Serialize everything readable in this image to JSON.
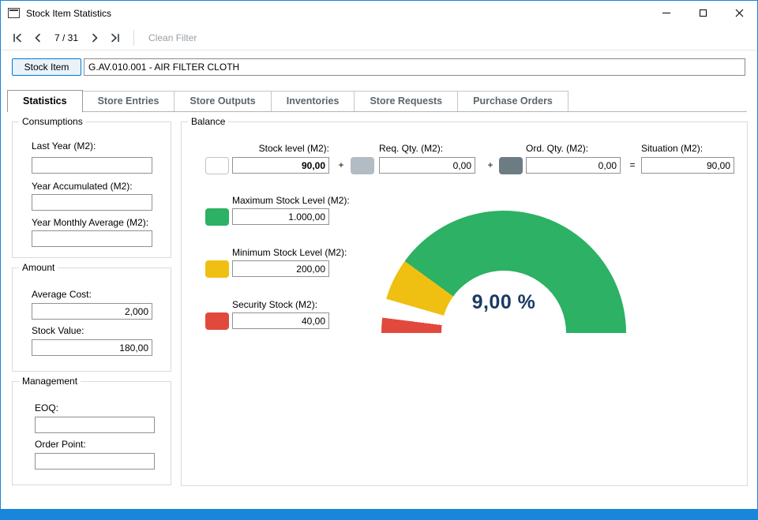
{
  "window": {
    "title": "Stock Item Statistics"
  },
  "toolbar": {
    "position": "7 / 31",
    "clean_filter": "Clean Filter"
  },
  "stock_item": {
    "button": "Stock Item",
    "value": "G.AV.010.001 - AIR FILTER CLOTH"
  },
  "tabs": {
    "items": [
      {
        "label": "Statistics",
        "active": true
      },
      {
        "label": "Store Entries",
        "active": false
      },
      {
        "label": "Store Outputs",
        "active": false
      },
      {
        "label": "Inventories",
        "active": false
      },
      {
        "label": "Store Requests",
        "active": false
      },
      {
        "label": "Purchase Orders",
        "active": false
      }
    ]
  },
  "panels": {
    "consumptions": {
      "legend": "Consumptions",
      "fields": [
        {
          "label": "Last Year (M2):",
          "value": ""
        },
        {
          "label": "Year Accumulated (M2):",
          "value": ""
        },
        {
          "label": "Year Monthly Average (M2):",
          "value": ""
        }
      ]
    },
    "amount": {
      "legend": "Amount",
      "fields": [
        {
          "label": "Average Cost:",
          "value": "2,000"
        },
        {
          "label": "Stock Value:",
          "value": "180,00"
        }
      ]
    },
    "management": {
      "legend": "Management",
      "fields": [
        {
          "label": "EOQ:",
          "value": ""
        },
        {
          "label": "Order Point:",
          "value": ""
        }
      ]
    }
  },
  "balance": {
    "legend": "Balance",
    "operators": [
      "+",
      "+",
      "="
    ],
    "equation": {
      "stock_level": {
        "label": "Stock level (M2):",
        "value": "90,00"
      },
      "req_qty": {
        "label": "Req. Qty. (M2):",
        "value": "0,00"
      },
      "ord_qty": {
        "label": "Ord. Qty. (M2):",
        "value": "0,00"
      },
      "situation": {
        "label": "Situation (M2):",
        "value": "90,00"
      }
    },
    "levels": [
      {
        "label": "Maximum Stock Level (M2):",
        "value": "1.000,00",
        "color": "#2cb165"
      },
      {
        "label": "Minimum Stock  Level (M2):",
        "value": "200,00",
        "color": "#efc012"
      },
      {
        "label": "Security Stock (M2):",
        "value": "40,00",
        "color": "#e1493d"
      }
    ],
    "gauge": {
      "percent_label": "9,00 %",
      "sweep_deg": 180,
      "segments": [
        {
          "name": "security-zone",
          "color": "#e1493d",
          "from_pct": 0,
          "to_pct": 4
        },
        {
          "name": "current-stock-marker",
          "color": "#ffffff",
          "from_pct": 4,
          "to_pct": 9
        },
        {
          "name": "minimum-zone",
          "color": "#efc012",
          "from_pct": 9,
          "to_pct": 20
        },
        {
          "name": "normal-zone",
          "color": "#2cb165",
          "from_pct": 20,
          "to_pct": 100
        }
      ]
    }
  },
  "colors": {
    "window_border": "#1a86d9",
    "statusbar": "#1a86d9",
    "stock_button_border": "#0078d7",
    "stock_button_bg": "#e7f2fb",
    "swatch_stock": "#ffffff",
    "swatch_req": "#b3bcc2",
    "swatch_ord": "#6d7b83",
    "percent_text": "#1b3a63"
  }
}
